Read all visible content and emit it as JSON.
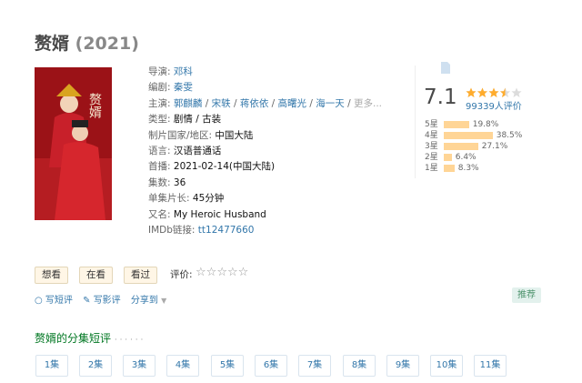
{
  "title": {
    "name": "赘婿",
    "year": "(2021)"
  },
  "info": {
    "director_label": "导演:",
    "director": "邓科",
    "writer_label": "编剧:",
    "writer": "秦雯",
    "cast_label": "主演:",
    "cast": [
      "郭麒麟",
      "宋轶",
      "蒋依依",
      "高曙光",
      "海一天"
    ],
    "cast_more": "更多...",
    "genre_label": "类型:",
    "genre": [
      "剧情",
      "古装"
    ],
    "region_label": "制片国家/地区:",
    "region": "中国大陆",
    "language_label": "语言:",
    "language": "汉语普通话",
    "release_label": "首播:",
    "release": "2021-02-14(中国大陆)",
    "episodes_label": "集数:",
    "episodes": "36",
    "runtime_label": "单集片长:",
    "runtime": "45分钟",
    "aka_label": "又名:",
    "aka": "My Heroic Husband",
    "imdb_label": "IMDb链接:",
    "imdb": "tt12477660"
  },
  "rating": {
    "score": "7.1",
    "count": "99339人评价",
    "stars_value": 3.5,
    "distribution": [
      {
        "label": "5星",
        "pct": "19.8%",
        "value": 19.8
      },
      {
        "label": "4星",
        "pct": "38.5%",
        "value": 38.5
      },
      {
        "label": "3星",
        "pct": "27.1%",
        "value": 27.1
      },
      {
        "label": "2星",
        "pct": "6.4%",
        "value": 6.4
      },
      {
        "label": "1星",
        "pct": "8.3%",
        "value": 8.3
      }
    ]
  },
  "actions": {
    "want": "想看",
    "watching": "在看",
    "watched": "看过",
    "rate_label": "评价:",
    "short_review": "写短评",
    "long_review": "写影评",
    "share": "分享到",
    "recommend": "推荐"
  },
  "episodes_section": {
    "title": "赘婿的分集短评",
    "dots": "· · · · · ·",
    "items": [
      "1集",
      "2集",
      "3集",
      "4集",
      "5集",
      "6集",
      "7集",
      "8集",
      "9集",
      "10集",
      "11集"
    ]
  },
  "colors": {
    "link": "#3377aa",
    "bar": "#ffd596",
    "star": "#ffac2d",
    "section_title": "#007722"
  }
}
